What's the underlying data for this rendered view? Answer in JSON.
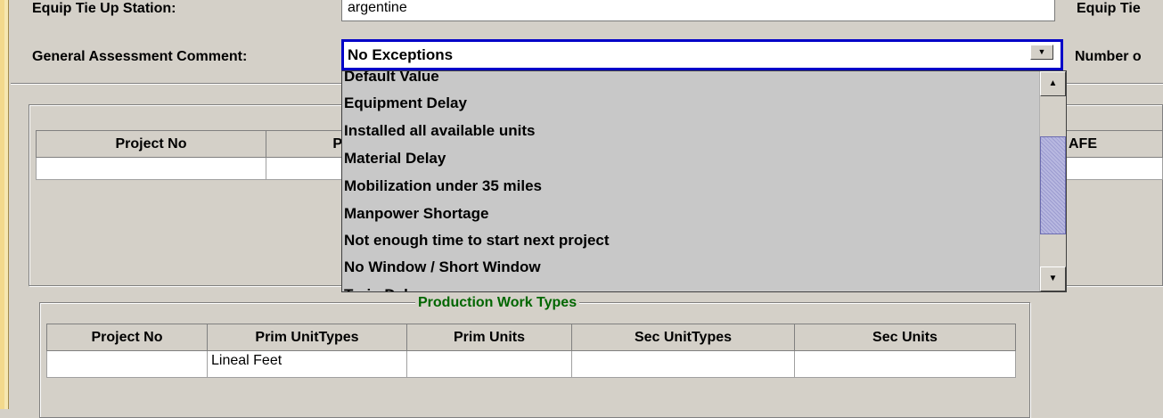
{
  "form": {
    "equip_tie_up_station_label": "Equip Tie Up Station:",
    "equip_tie_up_station_value": "argentine",
    "equip_tie_right_label": "Equip Tie",
    "general_assessment_label": "General Assessment Comment:",
    "general_assessment_value": "No Exceptions",
    "number_right_label": "Number o"
  },
  "dropdown": {
    "items": [
      "Default Value",
      "Equipment Delay",
      "Installed all available units",
      "Material Delay",
      "Mobilization under 35 miles",
      "Manpower Shortage",
      "Not enough time to start next project",
      "No Window / Short Window",
      "Train Delay"
    ],
    "scroll_position": 0.55
  },
  "project_table": {
    "columns": [
      "Project No",
      "P",
      "AFE"
    ],
    "rows": [
      [
        "",
        "",
        ""
      ]
    ]
  },
  "production_work_types": {
    "title": "Production Work Types",
    "columns": [
      "Project No",
      "Prim UnitTypes",
      "Prim Units",
      "Sec UnitTypes",
      "Sec Units"
    ],
    "rows": [
      [
        "",
        "Lineal Feet",
        "",
        "",
        ""
      ]
    ]
  },
  "icons": {
    "combo_arrow": "chevron-down-icon",
    "scroll_up": "arrow-up-icon",
    "scroll_down": "arrow-down-icon"
  },
  "colors": {
    "focus_border": "#0000c8",
    "group_title": "#006600",
    "left_rail": "#f2d98c"
  }
}
